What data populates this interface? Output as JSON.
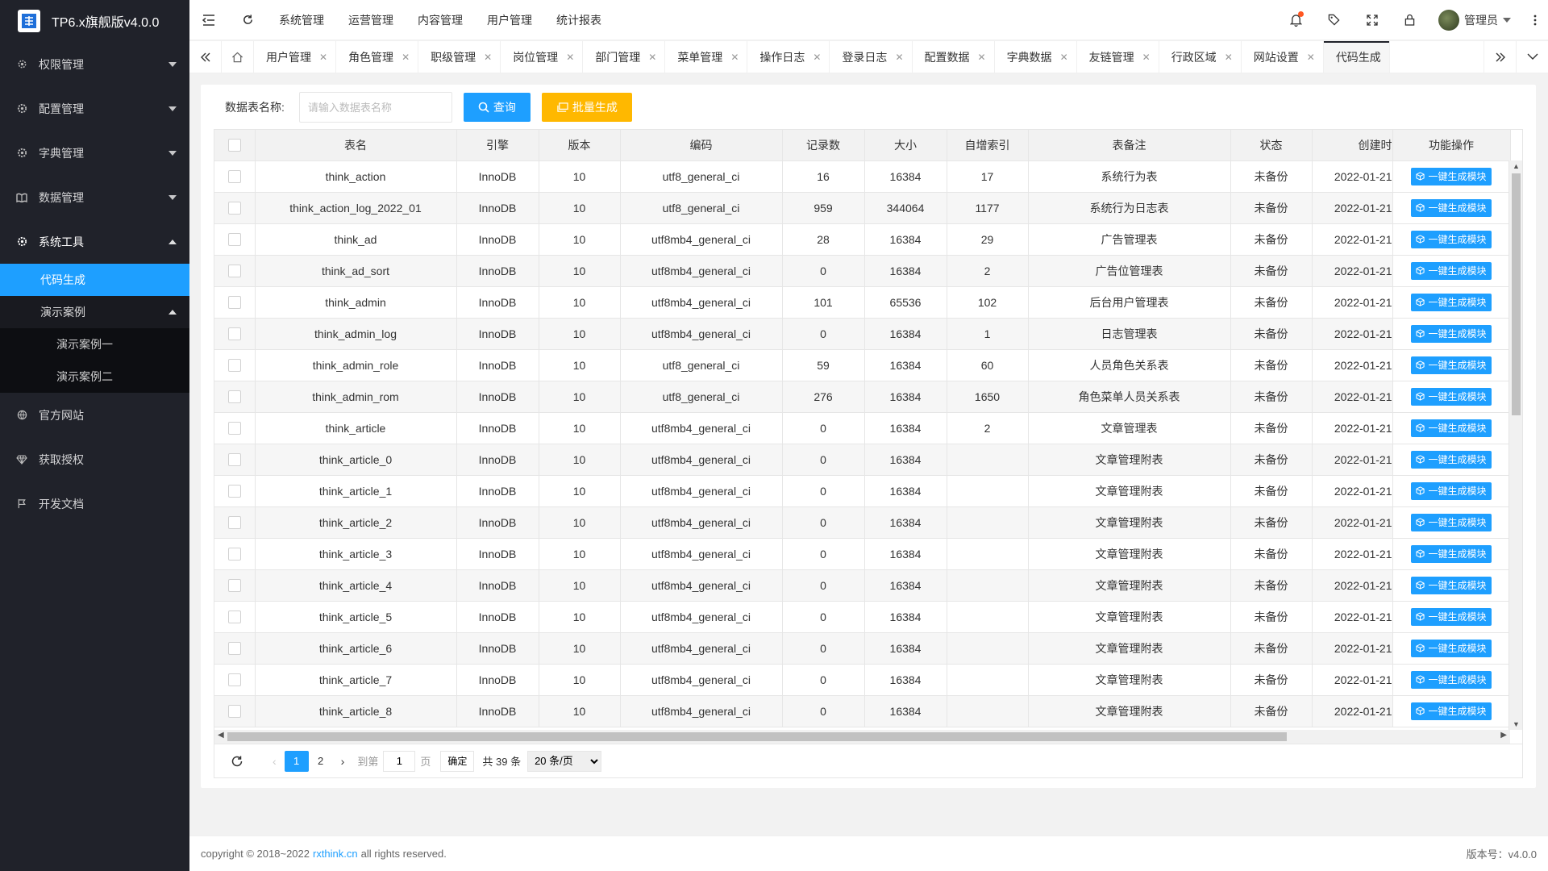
{
  "app": {
    "title": "TP6.x旗舰版v4.0.0"
  },
  "sidebar": {
    "items": [
      {
        "label": "权限管理",
        "icon": "gear-icon"
      },
      {
        "label": "配置管理",
        "icon": "gear-icon"
      },
      {
        "label": "字典管理",
        "icon": "gear-icon"
      },
      {
        "label": "数据管理",
        "icon": "book-icon"
      },
      {
        "label": "系统工具",
        "icon": "gear-icon"
      },
      {
        "label": "官方网站",
        "icon": "globe-icon"
      },
      {
        "label": "获取授权",
        "icon": "diamond-icon"
      },
      {
        "label": "开发文档",
        "icon": "flag-icon"
      }
    ],
    "sub": {
      "code_gen": "代码生成",
      "demo": "演示案例"
    },
    "sub2": [
      "演示案例一",
      "演示案例二"
    ]
  },
  "header": {
    "menu": [
      "系统管理",
      "运营管理",
      "内容管理",
      "用户管理",
      "统计报表"
    ],
    "user": "管理员"
  },
  "tabs": [
    "用户管理",
    "角色管理",
    "职级管理",
    "岗位管理",
    "部门管理",
    "菜单管理",
    "操作日志",
    "登录日志",
    "配置数据",
    "字典数据",
    "友链管理",
    "行政区域",
    "网站设置",
    "代码生成"
  ],
  "search": {
    "label": "数据表名称:",
    "placeholder": "请输入数据表名称",
    "query_btn": "查询",
    "batch_btn": "批量生成"
  },
  "table": {
    "columns": [
      "表名",
      "引擎",
      "版本",
      "编码",
      "记录数",
      "大小",
      "自增索引",
      "表备注",
      "状态",
      "创建时",
      "功能操作"
    ],
    "action_label": "一键生成模块",
    "rows": [
      [
        "think_action",
        "InnoDB",
        "10",
        "utf8_general_ci",
        "16",
        "16384",
        "17",
        "系统行为表",
        "未备份",
        "2022-01-21"
      ],
      [
        "think_action_log_2022_01",
        "InnoDB",
        "10",
        "utf8_general_ci",
        "959",
        "344064",
        "1177",
        "系统行为日志表",
        "未备份",
        "2022-01-21"
      ],
      [
        "think_ad",
        "InnoDB",
        "10",
        "utf8mb4_general_ci",
        "28",
        "16384",
        "29",
        "广告管理表",
        "未备份",
        "2022-01-21"
      ],
      [
        "think_ad_sort",
        "InnoDB",
        "10",
        "utf8mb4_general_ci",
        "0",
        "16384",
        "2",
        "广告位管理表",
        "未备份",
        "2022-01-21"
      ],
      [
        "think_admin",
        "InnoDB",
        "10",
        "utf8mb4_general_ci",
        "101",
        "65536",
        "102",
        "后台用户管理表",
        "未备份",
        "2022-01-21"
      ],
      [
        "think_admin_log",
        "InnoDB",
        "10",
        "utf8mb4_general_ci",
        "0",
        "16384",
        "1",
        "日志管理表",
        "未备份",
        "2022-01-21"
      ],
      [
        "think_admin_role",
        "InnoDB",
        "10",
        "utf8_general_ci",
        "59",
        "16384",
        "60",
        "人员角色关系表",
        "未备份",
        "2022-01-21"
      ],
      [
        "think_admin_rom",
        "InnoDB",
        "10",
        "utf8_general_ci",
        "276",
        "16384",
        "1650",
        "角色菜单人员关系表",
        "未备份",
        "2022-01-21"
      ],
      [
        "think_article",
        "InnoDB",
        "10",
        "utf8mb4_general_ci",
        "0",
        "16384",
        "2",
        "文章管理表",
        "未备份",
        "2022-01-21"
      ],
      [
        "think_article_0",
        "InnoDB",
        "10",
        "utf8mb4_general_ci",
        "0",
        "16384",
        "",
        "文章管理附表",
        "未备份",
        "2022-01-21"
      ],
      [
        "think_article_1",
        "InnoDB",
        "10",
        "utf8mb4_general_ci",
        "0",
        "16384",
        "",
        "文章管理附表",
        "未备份",
        "2022-01-21"
      ],
      [
        "think_article_2",
        "InnoDB",
        "10",
        "utf8mb4_general_ci",
        "0",
        "16384",
        "",
        "文章管理附表",
        "未备份",
        "2022-01-21"
      ],
      [
        "think_article_3",
        "InnoDB",
        "10",
        "utf8mb4_general_ci",
        "0",
        "16384",
        "",
        "文章管理附表",
        "未备份",
        "2022-01-21"
      ],
      [
        "think_article_4",
        "InnoDB",
        "10",
        "utf8mb4_general_ci",
        "0",
        "16384",
        "",
        "文章管理附表",
        "未备份",
        "2022-01-21"
      ],
      [
        "think_article_5",
        "InnoDB",
        "10",
        "utf8mb4_general_ci",
        "0",
        "16384",
        "",
        "文章管理附表",
        "未备份",
        "2022-01-21"
      ],
      [
        "think_article_6",
        "InnoDB",
        "10",
        "utf8mb4_general_ci",
        "0",
        "16384",
        "",
        "文章管理附表",
        "未备份",
        "2022-01-21"
      ],
      [
        "think_article_7",
        "InnoDB",
        "10",
        "utf8mb4_general_ci",
        "0",
        "16384",
        "",
        "文章管理附表",
        "未备份",
        "2022-01-21"
      ],
      [
        "think_article_8",
        "InnoDB",
        "10",
        "utf8mb4_general_ci",
        "0",
        "16384",
        "",
        "文章管理附表",
        "未备份",
        "2022-01-21"
      ]
    ]
  },
  "pager": {
    "pages": [
      "1",
      "2"
    ],
    "goto_prefix": "到第",
    "goto_value": "1",
    "goto_suffix": "页",
    "ok": "确定",
    "total": "共 39 条",
    "page_size": "20 条/页"
  },
  "footer": {
    "copyright_prefix": "copyright © 2018~2022",
    "link": "rxthink.cn",
    "copyright_suffix": "all rights reserved.",
    "version": "版本号：v4.0.0"
  },
  "colors": {
    "accent": "#1e9fff",
    "warn": "#ffb800",
    "sidebar": "#20222a"
  }
}
